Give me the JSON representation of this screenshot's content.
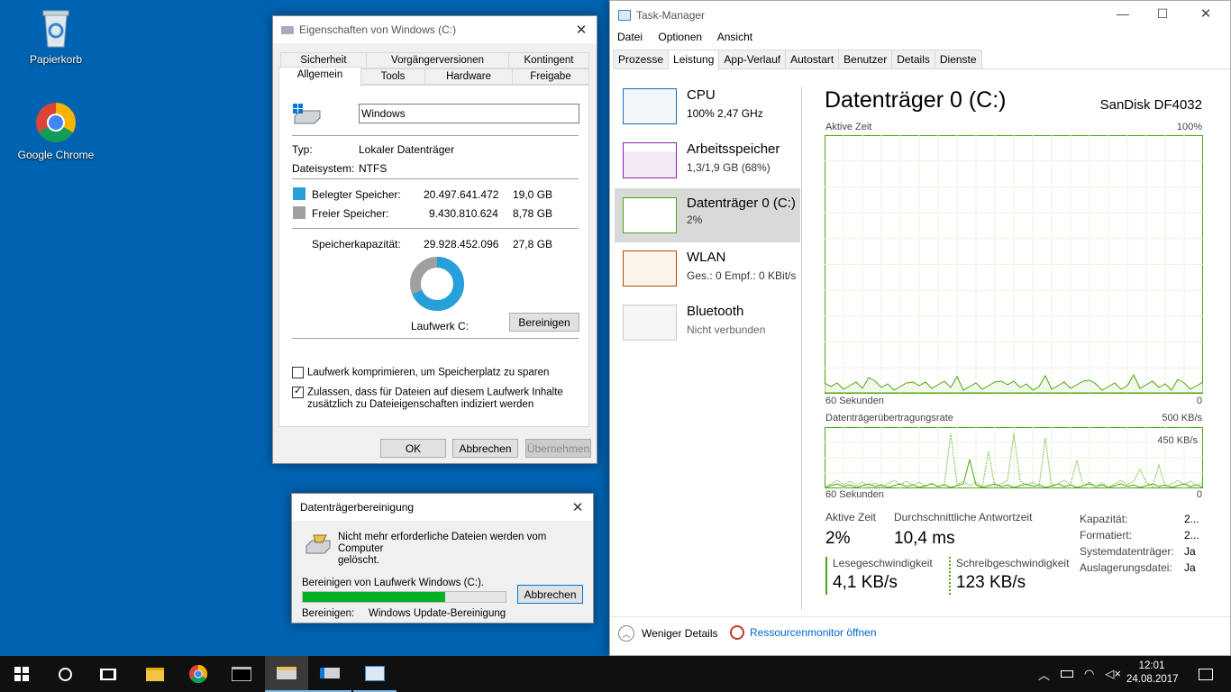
{
  "desktop": {
    "icons": [
      {
        "label": "Papierkorb",
        "icon": "recycle-bin-icon"
      },
      {
        "label": "Google Chrome",
        "icon": "chrome-icon"
      }
    ]
  },
  "props": {
    "title": "Eigenschaften von Windows (C:)",
    "tabs_row1": [
      "Sicherheit",
      "Vorgängerversionen",
      "Kontingent"
    ],
    "tabs_row2": [
      "Allgemein",
      "Tools",
      "Hardware",
      "Freigabe"
    ],
    "name_value": "Windows",
    "type_label": "Typ:",
    "type_value": "Lokaler Datenträger",
    "fs_label": "Dateisystem:",
    "fs_value": "NTFS",
    "used_label": "Belegter Speicher:",
    "used_bytes": "20.497.641.472",
    "used_gb": "19,0 GB",
    "free_label": "Freier Speicher:",
    "free_bytes": "9.430.810.624",
    "free_gb": "8,78 GB",
    "cap_label": "Speicherkapazität:",
    "cap_bytes": "29.928.452.096",
    "cap_gb": "27,8 GB",
    "used_fraction": 0.685,
    "drive_label": "Laufwerk C:",
    "cleanup_btn": "Bereinigen",
    "compress_label": "Laufwerk komprimieren, um Speicherplatz zu sparen",
    "index_label_1": "Zulassen, dass für Dateien auf diesem Laufwerk Inhalte",
    "index_label_2": "zusätzlich zu Dateieigenschaften indiziert werden",
    "ok": "OK",
    "cancel": "Abbrechen",
    "apply": "Übernehmen",
    "colors": {
      "used": "#26a0da",
      "free": "#a0a0a0"
    }
  },
  "cleanup": {
    "title": "Datenträgerbereinigung",
    "message_1": "Nicht mehr erforderliche Dateien werden vom Computer",
    "message_2": "gelöscht.",
    "progress_label": "Bereinigen von Laufwerk Windows (C:).",
    "progress": 0.7,
    "cancel": "Abbrechen",
    "status_label": "Bereinigen:",
    "status_value": "Windows Update-Bereinigung"
  },
  "taskmgr": {
    "title": "Task-Manager",
    "menu": [
      "Datei",
      "Optionen",
      "Ansicht"
    ],
    "tabs": [
      "Prozesse",
      "Leistung",
      "App-Verlauf",
      "Autostart",
      "Benutzer",
      "Details",
      "Dienste"
    ],
    "sidebar": [
      {
        "name": "CPU",
        "sub": "100%  2,47 GHz",
        "color": "#1a6fb5"
      },
      {
        "name": "Arbeitsspeicher",
        "sub": "1,3/1,9 GB (68%)",
        "color": "#8b21a6"
      },
      {
        "name": "Datenträger 0 (C:)",
        "sub": "2%",
        "color": "#4da60c"
      },
      {
        "name": "WLAN",
        "sub": "Ges.: 0  Empf.: 0 KBit/s",
        "color": "#a74f01"
      },
      {
        "name": "Bluetooth",
        "sub": "Nicht verbunden",
        "color": "#aaaaaa"
      }
    ],
    "main_title": "Datenträger 0 (C:)",
    "device": "SanDisk DF4032",
    "graph1_label": "Aktive Zeit",
    "graph1_max": "100%",
    "graph1_time": "60 Sekunden",
    "graph1_min": "0",
    "graph2_label": "Datenträgerübertragungsrate",
    "graph2_max": "500 KB/s",
    "graph2_mark": "450 KB/s",
    "graph2_time": "60 Sekunden",
    "graph2_min": "0",
    "stats": {
      "active_label": "Aktive Zeit",
      "active_value": "2%",
      "resp_label": "Durchschnittliche Antwortzeit",
      "resp_value": "10,4 ms",
      "read_label": "Lesegeschwindigkeit",
      "read_value": "4,1 KB/s",
      "write_label": "Schreibgeschwindigkeit",
      "write_value": "123 KB/s",
      "info": [
        {
          "k": "Kapazität:",
          "v": "2..."
        },
        {
          "k": "Formatiert:",
          "v": "2..."
        },
        {
          "k": "Systemdatenträger:",
          "v": "Ja"
        },
        {
          "k": "Auslagerungsdatei:",
          "v": "Ja"
        }
      ]
    },
    "fewer_details": "Weniger Details",
    "resmon": "Ressourcenmonitor öffnen"
  },
  "taskbar": {
    "time": "12:01",
    "date": "24.08.2017"
  }
}
